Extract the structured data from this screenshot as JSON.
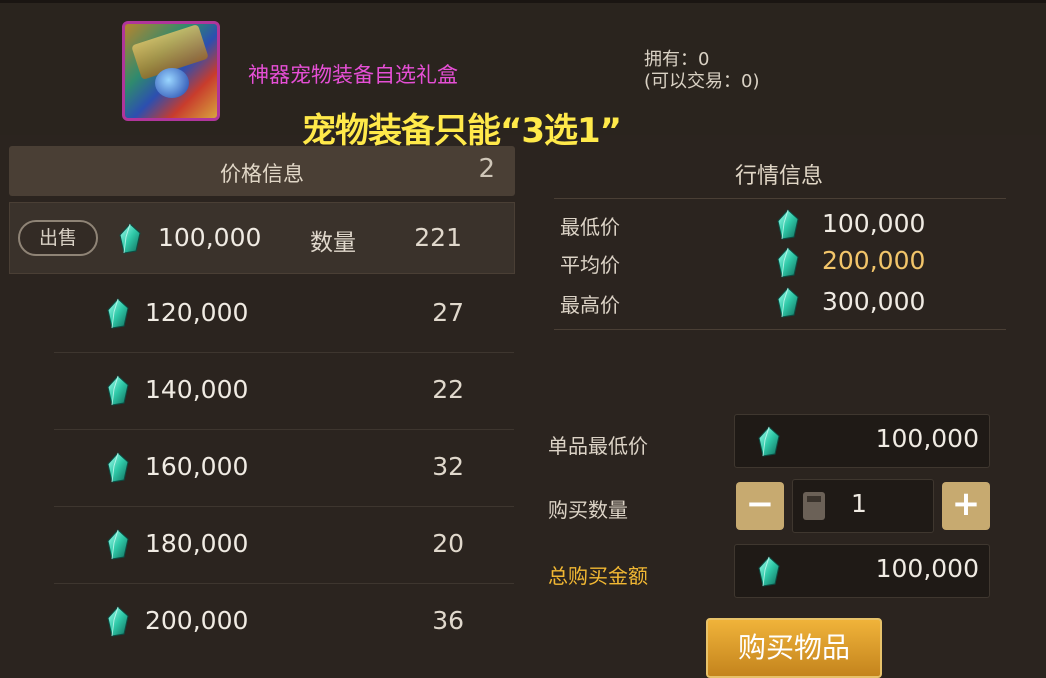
{
  "item": {
    "name": "神器宠物装备自选礼盒",
    "owned": "拥有：0",
    "tradable": "(可以交易：0)"
  },
  "banner": "宠物装备只能“3选1”",
  "price_panel": {
    "title": "价格信息",
    "count": "2",
    "sell_label": "出售",
    "qty_label": "数量",
    "top_row": {
      "price": "100,000",
      "qty": "221"
    },
    "rows": [
      {
        "price": "120,000",
        "qty": "27"
      },
      {
        "price": "140,000",
        "qty": "22"
      },
      {
        "price": "160,000",
        "qty": "32"
      },
      {
        "price": "180,000",
        "qty": "20"
      },
      {
        "price": "200,000",
        "qty": "36"
      }
    ]
  },
  "market": {
    "title": "行情信息",
    "min_label": "最低价",
    "min_value": "100,000",
    "avg_label": "平均价",
    "avg_value": "200,000",
    "max_label": "最高价",
    "max_value": "300,000"
  },
  "buy_form": {
    "unit_min_label": "单品最低价",
    "unit_min_value": "100,000",
    "qty_label": "购买数量",
    "qty_value": "1",
    "minus": "−",
    "plus": "+",
    "total_label": "总购买金额",
    "total_value": "100,000",
    "buy_button": "购买物品"
  },
  "colors": {
    "accent_gold": "#f2b833",
    "item_name": "#e64fd6",
    "banner": "#ffe94a"
  }
}
